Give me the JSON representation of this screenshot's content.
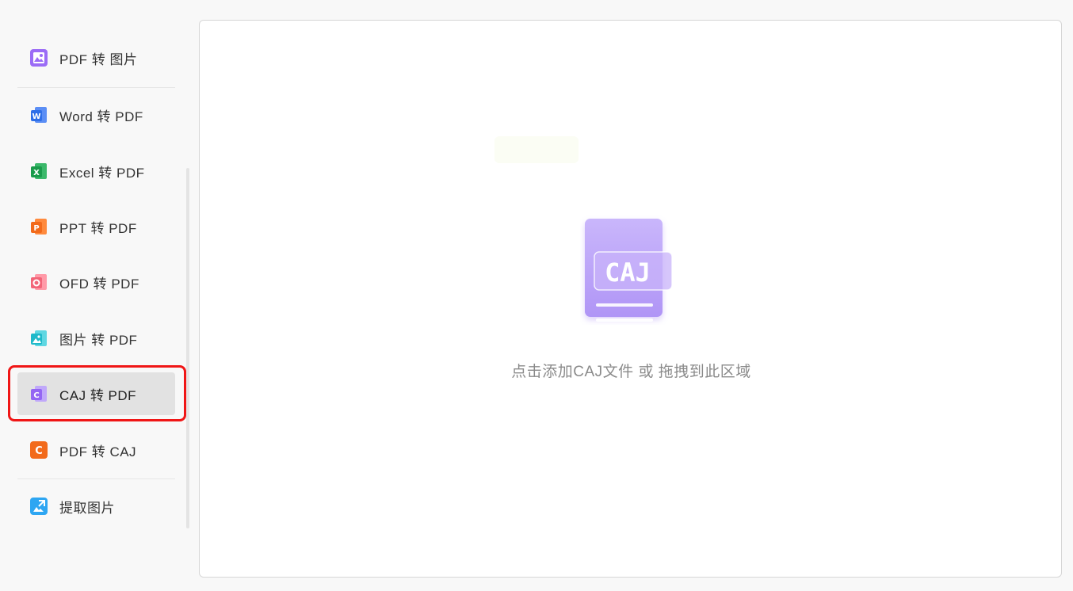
{
  "sidebar": {
    "items": [
      {
        "label": "PDF 转 图片",
        "icon": "pdf-to-image-icon"
      },
      {
        "label": "Word 转 PDF",
        "icon": "word-icon"
      },
      {
        "label": "Excel 转 PDF",
        "icon": "excel-icon"
      },
      {
        "label": "PPT 转 PDF",
        "icon": "ppt-icon"
      },
      {
        "label": "OFD 转 PDF",
        "icon": "ofd-icon"
      },
      {
        "label": "图片 转 PDF",
        "icon": "image-icon"
      },
      {
        "label": "CAJ 转 PDF",
        "icon": "caj-icon",
        "active": true
      },
      {
        "label": "PDF 转 CAJ",
        "icon": "pdf-to-caj-icon"
      },
      {
        "label": "提取图片",
        "icon": "extract-image-icon"
      }
    ],
    "highlight_color": "#f01616"
  },
  "dropzone": {
    "illustration_text": "CAJ",
    "hint": "点击添加CAJ文件 或 拖拽到此区域"
  },
  "colors": {
    "caj_purple": "#b9a0f5",
    "active_bg": "#e2e2e2"
  }
}
